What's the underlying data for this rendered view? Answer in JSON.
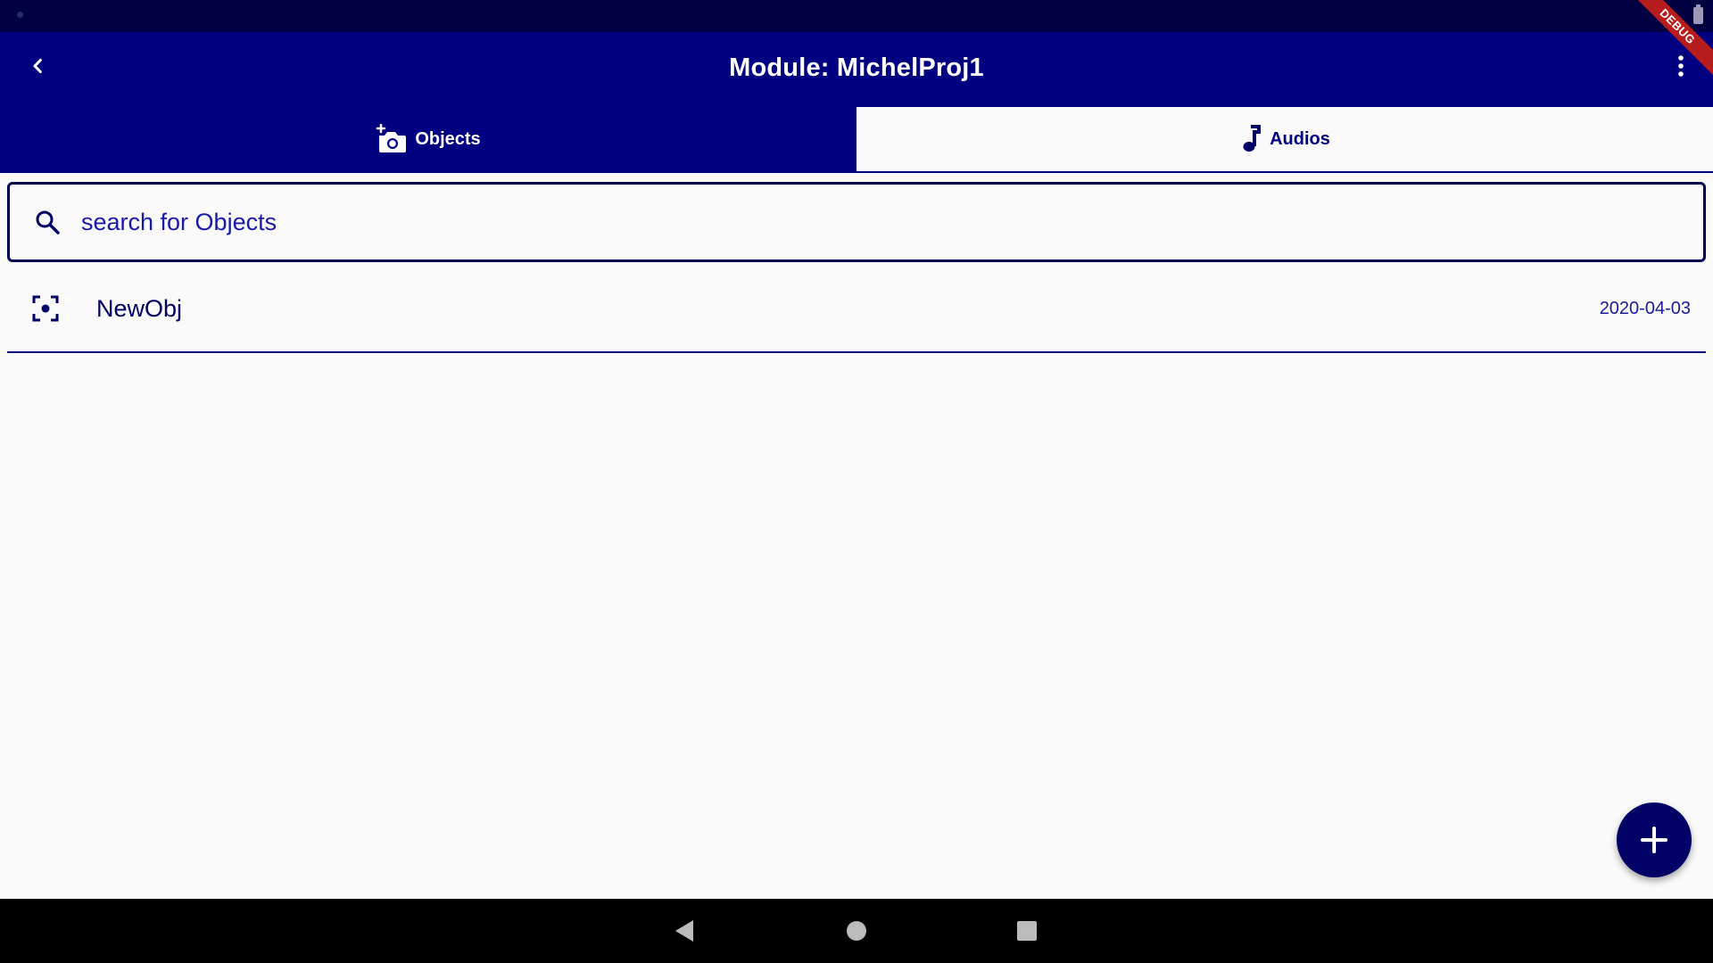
{
  "header": {
    "title": "Module: MichelProj1"
  },
  "tabs": [
    {
      "label": "Objects",
      "icon": "add-camera-icon",
      "active": true
    },
    {
      "label": "Audios",
      "icon": "music-note-icon",
      "active": false
    }
  ],
  "search": {
    "placeholder": "search for Objects",
    "value": ""
  },
  "list": {
    "items": [
      {
        "name": "NewObj",
        "date": "2020-04-03",
        "icon": "center-focus-icon"
      }
    ]
  },
  "debug_banner": {
    "label": "DEBUG"
  },
  "colors": {
    "primary": "#000080",
    "status_bar": "#000042",
    "background": "#fafafa",
    "debug": "#b71c1c"
  }
}
